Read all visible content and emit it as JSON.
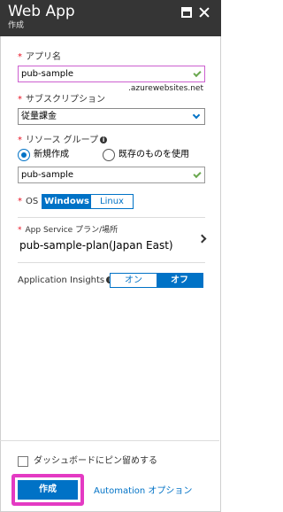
{
  "header": {
    "title": "Web App",
    "subtitle": "作成"
  },
  "form": {
    "app_name": {
      "label": "アプリ名",
      "value": "pub-sample",
      "suffix": ".azurewebsites.net"
    },
    "subscription": {
      "label": "サブスクリプション",
      "value": "従量課金"
    },
    "resource_group": {
      "label": "リソース グループ",
      "options": [
        "新規作成",
        "既存のものを使用"
      ],
      "selected": "新規作成",
      "value": "pub-sample"
    },
    "os": {
      "label": "OS",
      "options": [
        "Windows",
        "Linux"
      ],
      "selected": "Windows"
    },
    "app_service_plan": {
      "label": "App Service プラン/場所",
      "value": "pub-sample-plan(Japan East)"
    },
    "app_insights": {
      "label": "Application Insights",
      "options": [
        "オン",
        "オフ"
      ],
      "selected": "オフ"
    }
  },
  "footer": {
    "pin_label": "ダッシュボードにピン留めする",
    "create_label": "作成",
    "automation_label": "Automation オプション"
  },
  "colors": {
    "accent": "#0072c6",
    "header_bg": "#353535",
    "required": "#e81123",
    "highlight": "#e43ac3",
    "valid_check": "#6aa84f"
  }
}
